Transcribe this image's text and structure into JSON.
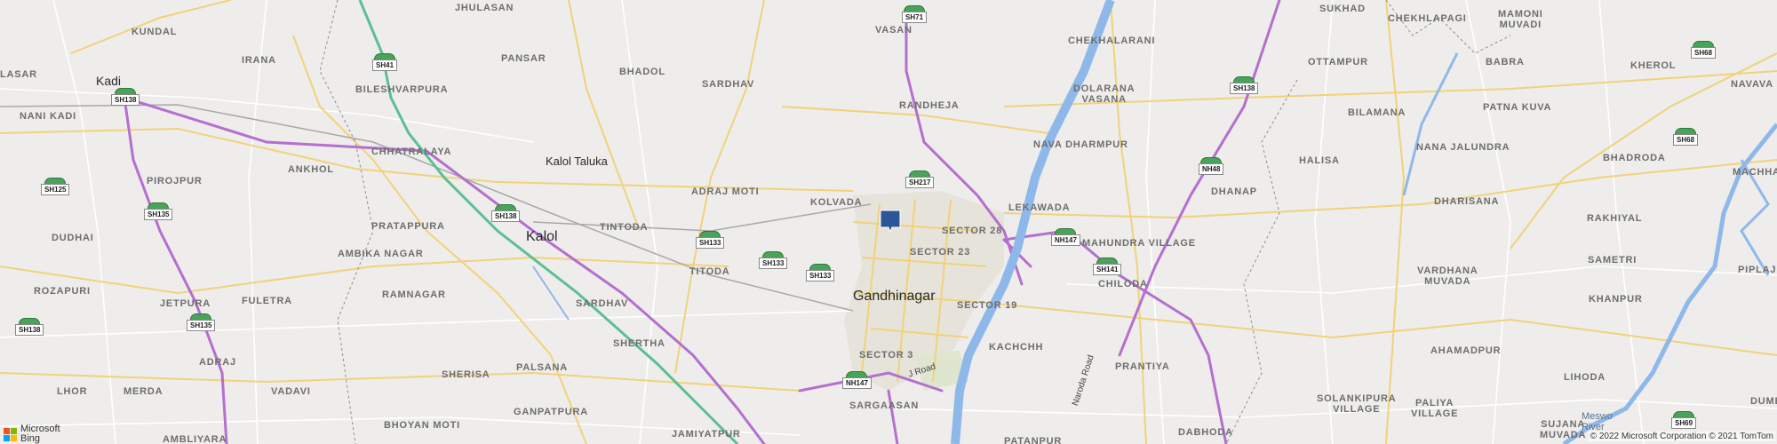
{
  "map": {
    "labels": {
      "kundal": "KUNDAL",
      "lasar": "LASAR",
      "kadi": "Kadi",
      "irana": "IRANA",
      "jhulasan": "JHULASAN",
      "pansar": "PANSAR",
      "bileshvarpura": "BILESHVARPURA",
      "bhadol": "BHADOL",
      "sardhav_n": "SARDHAV",
      "vasan": "VASAN",
      "randheja": "RANDHEJA",
      "chekhalarani": "CHEKHALARANI",
      "dolarana_vasana": "DOLARANA\nVASANA",
      "sukhad": "SUKHAD",
      "chekhlapagi": "CHEKHLAPAGI",
      "mamoni_muvadi": "MAMONI\nMUVADI",
      "ottampur": "OTTAMPUR",
      "babra": "BABRA",
      "kherol": "KHEROL",
      "navava": "NAVAVA",
      "bilamana": "BILAMANA",
      "patna_kuva": "PATNA KUVA",
      "nani_kadi": "NANI KADI",
      "chhatralaya": "CHHATRALAYA",
      "kalol_taluka": "Kalol Taluka",
      "nava_dharmpur": "NAVA DHARMPUR",
      "halisa": "HALISA",
      "nana_jalundra": "NANA JALUNDRA",
      "bhadroda": "BHADRODA",
      "ankhol": "ANKHOL",
      "pirojpur": "PIROJPUR",
      "adraj_moti": "ADRAJ MOTI",
      "machha": "MACHHA",
      "kolvada": "KOLVADA",
      "lekawada": "LEKAWADA",
      "dhanap": "DHANAP",
      "dharisana": "DHARISANA",
      "rakhiyal": "RAKHIYAL",
      "pratappura": "PRATAPPURA",
      "tintoda": "TINTODA",
      "dudhai": "DUDHAI",
      "kalol": "Kalol",
      "sector_28": "SECTOR 28",
      "mahundra_village": "MAHUNDRA VILLAGE",
      "ambika_nagar": "AMBIKA NAGAR",
      "sector_23": "SECTOR 23",
      "titoda": "TITODA",
      "samatri": "SAMETRI",
      "piplaj": "PIPLAJ",
      "chiloda": "CHILODA",
      "vardhana_muvada": "VARDHANA\nMUVADA",
      "rozapuri": "ROZAPURI",
      "gandhinagar": "Gandhinagar",
      "ramnagar": "RAMNAGAR",
      "fuletra": "FULETRA",
      "jetpura": "JETPURA",
      "sardhav_s": "SARDHAV",
      "sector_19": "SECTOR 19",
      "khanpur": "KHANPUR",
      "shertha": "SHERTHA",
      "kachchh": "KACHCHH",
      "prantiya": "PRANTIYA",
      "ahamadpur": "AHAMADPUR",
      "adraj": "ADRAJ",
      "palsana": "PALSANA",
      "sector_3": "SECTOR 3",
      "j_road": "J Road",
      "sherisa": "SHERISA",
      "lhor": "LHOR",
      "merda": "MERDA",
      "vadavi": "VADAVI",
      "lihoda": "LIHODA",
      "solankipura_village": "SOLANKIPURA\nVILLAGE",
      "paliya_village": "PALIYA\nVILLAGE",
      "dume": "DUME",
      "meswo_river": "Meswo\nRiver",
      "naroda_road": "Naroda Road",
      "sargaasan": "SARGAASAN",
      "bhoyan_moti": "BHOYAN MOTI",
      "ganpatpura": "GANPATPURA",
      "jamiyatpur": "JAMIYATPUR",
      "dabhoda": "DABHODA",
      "sujana_muvada": "SUJANA\nMUVADA",
      "ambliyara": "AMBLIYARA",
      "patanpur": "PATANPUR"
    },
    "shields": {
      "sh71": "SH71",
      "sh41": "SH41",
      "sh138_kadi": "SH138",
      "sh138_east": "SH138",
      "sh68_ne": "SH68",
      "sh68_e": "SH68",
      "sh125": "SH125",
      "sh135_a": "SH135",
      "sh138_kalol": "SH138",
      "sh217": "SH217",
      "nh48": "NH48",
      "sh133_a": "SH133",
      "sh133_b": "SH133",
      "sh133_c": "SH133",
      "nh147_e": "NH147",
      "sh141": "SH141",
      "sh138_sw": "SH138",
      "sh135_b": "SH135",
      "nh147_s": "NH147",
      "sh69": "SH69"
    },
    "pin": {
      "icon": "location-square-pin",
      "color": "#2b5797"
    },
    "logo": {
      "line1": "Microsoft",
      "line2": "Bing"
    },
    "copyright": "© 2022 Microsoft Corporation © 2021 TomTom"
  }
}
